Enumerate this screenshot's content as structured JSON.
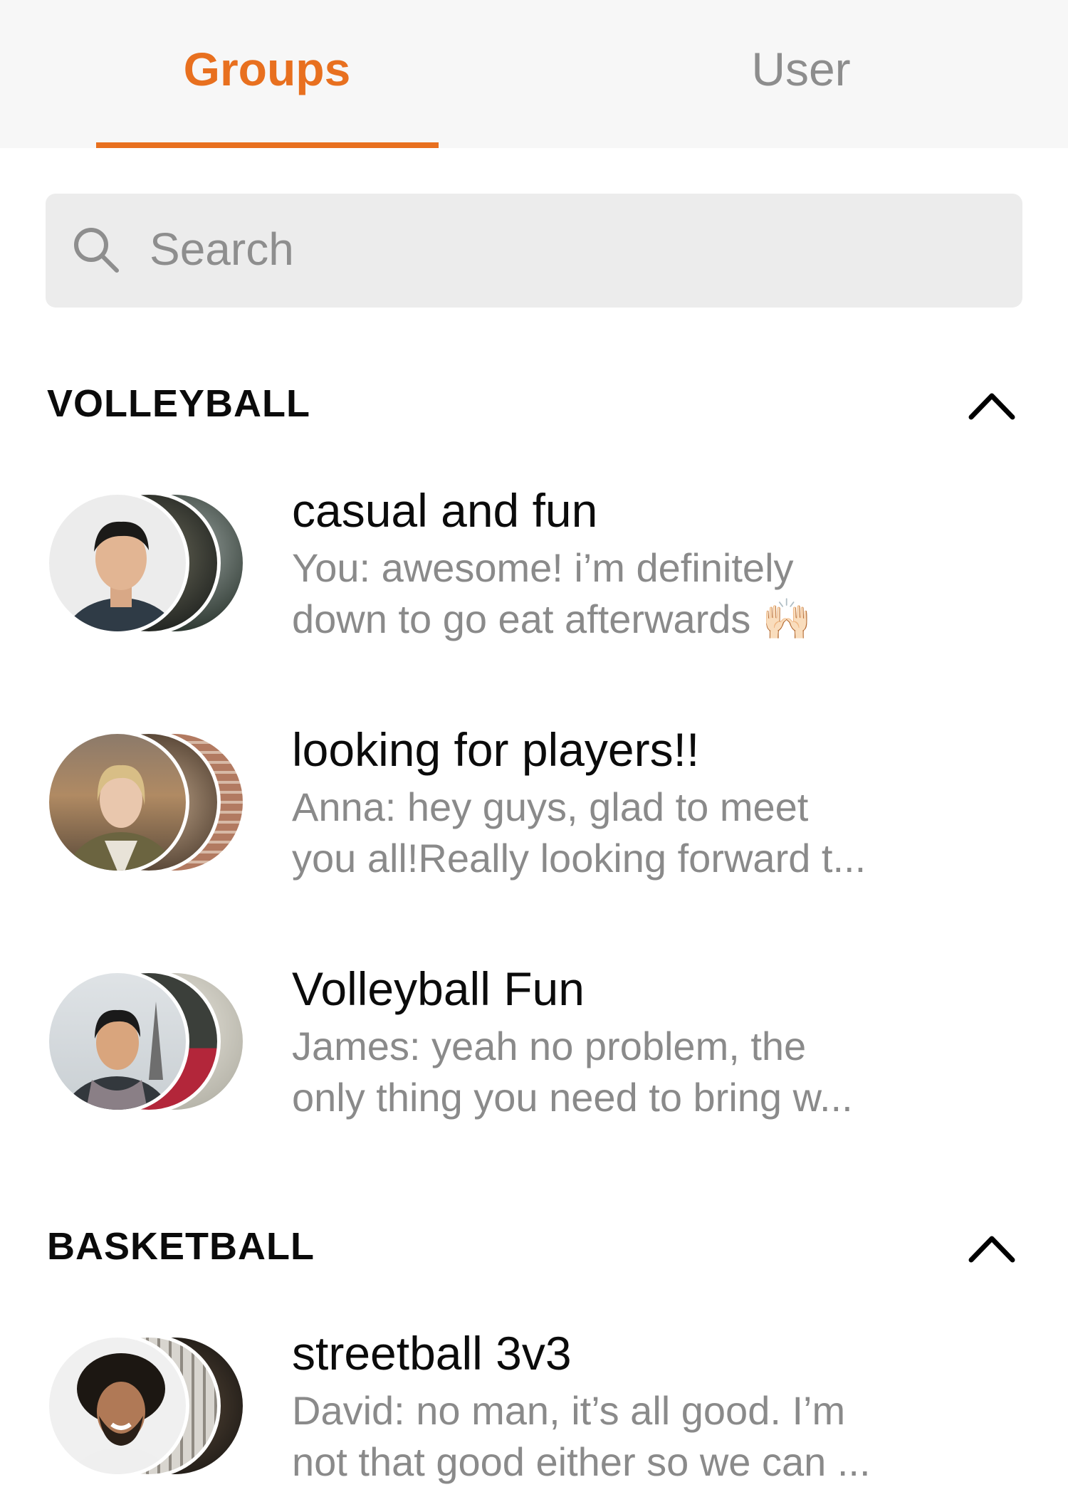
{
  "tabs": {
    "groups_label": "Groups",
    "user_label": "User",
    "active": "Groups"
  },
  "search": {
    "placeholder": "Search",
    "icon": "search-icon"
  },
  "colors": {
    "accent": "#e8701f",
    "inactive_tab": "#8d8d8d",
    "preview_text": "#8a8a8a",
    "search_bg": "#ececec"
  },
  "sections": [
    {
      "title": "VOLLEYBALL",
      "collapse_icon": "chevron-up-icon",
      "groups": [
        {
          "title": "casual and fun",
          "preview_line1": "You: awesome! i’m definitely",
          "preview_line2": "down to go eat afterwards 🙌🏻"
        },
        {
          "title": "looking for players!!",
          "preview_line1": "Anna: hey guys, glad to meet",
          "preview_line2": "you all!Really looking forward t..."
        },
        {
          "title": "Volleyball Fun",
          "preview_line1": "James: yeah no problem, the",
          "preview_line2": "only thing you need to bring w..."
        }
      ]
    },
    {
      "title": "BASKETBALL",
      "collapse_icon": "chevron-up-icon",
      "groups": [
        {
          "title": "streetball 3v3",
          "preview_line1": "David: no man, it’s all good. I’m",
          "preview_line2": "not that good either so we can ..."
        }
      ]
    }
  ]
}
